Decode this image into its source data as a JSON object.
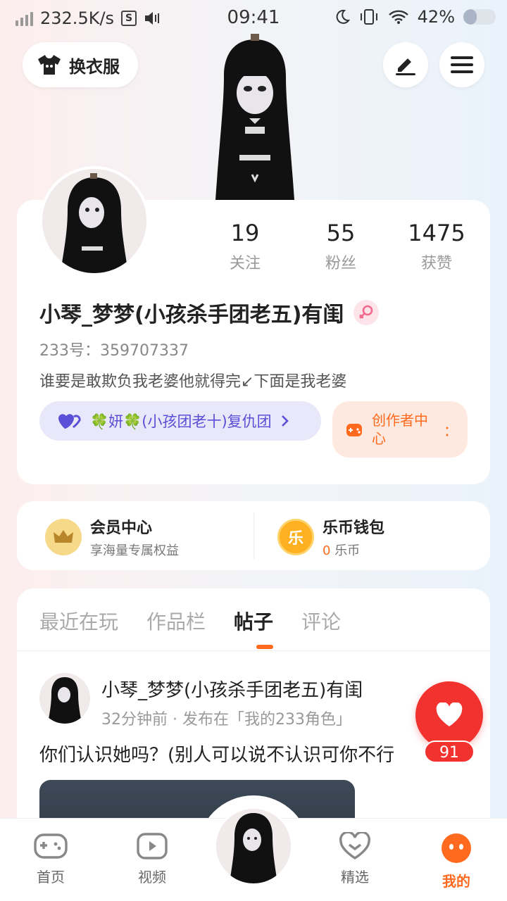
{
  "status_bar": {
    "net_speed": "232.5K/s",
    "s_badge": "S",
    "time": "09:41",
    "battery_percent": "42%",
    "battery_level": 0.42
  },
  "header": {
    "outfit_label": "换衣服"
  },
  "profile": {
    "stats": [
      {
        "value": "19",
        "label": "关注"
      },
      {
        "value": "55",
        "label": "粉丝"
      },
      {
        "value": "1475",
        "label": "获赞"
      }
    ],
    "nickname": "小琴_梦梦(小孩杀手团老五)有闺",
    "uid": "233号：359707337",
    "bio": "谁要是敢欺负我老婆他就得完↙下面是我老婆",
    "group_label": "🍀妍🍀(小孩团老十)复仇团",
    "creator_label": "创作者中心",
    "creator_more": "："
  },
  "services": {
    "member_title": "会员中心",
    "member_sub": "享海量专属权益",
    "wallet_title": "乐币钱包",
    "wallet_amount": "0",
    "wallet_unit": "乐币",
    "wallet_icon_char": "乐"
  },
  "tabs": [
    "最近在玩",
    "作品栏",
    "帖子",
    "评论"
  ],
  "active_tab": 2,
  "post": {
    "author": "小琴_梦梦(小孩杀手团老五)有闺",
    "meta": "32分钟前 · 发布在「我的233角色」",
    "text": "你们认识她吗？(别人可以说不认识可你不行",
    "like_count": "91"
  },
  "bottom_nav": [
    {
      "label": "首页",
      "icon": "gamepad-icon"
    },
    {
      "label": "视频",
      "icon": "video-play-icon"
    },
    {
      "label": "精选",
      "icon": "heart-chevron-icon"
    },
    {
      "label": "我的",
      "icon": "face-icon",
      "active": true
    }
  ],
  "colors": {
    "accent": "#ff6a1f",
    "like_red": "#f2322f",
    "group_purple": "#5a4fd6"
  }
}
